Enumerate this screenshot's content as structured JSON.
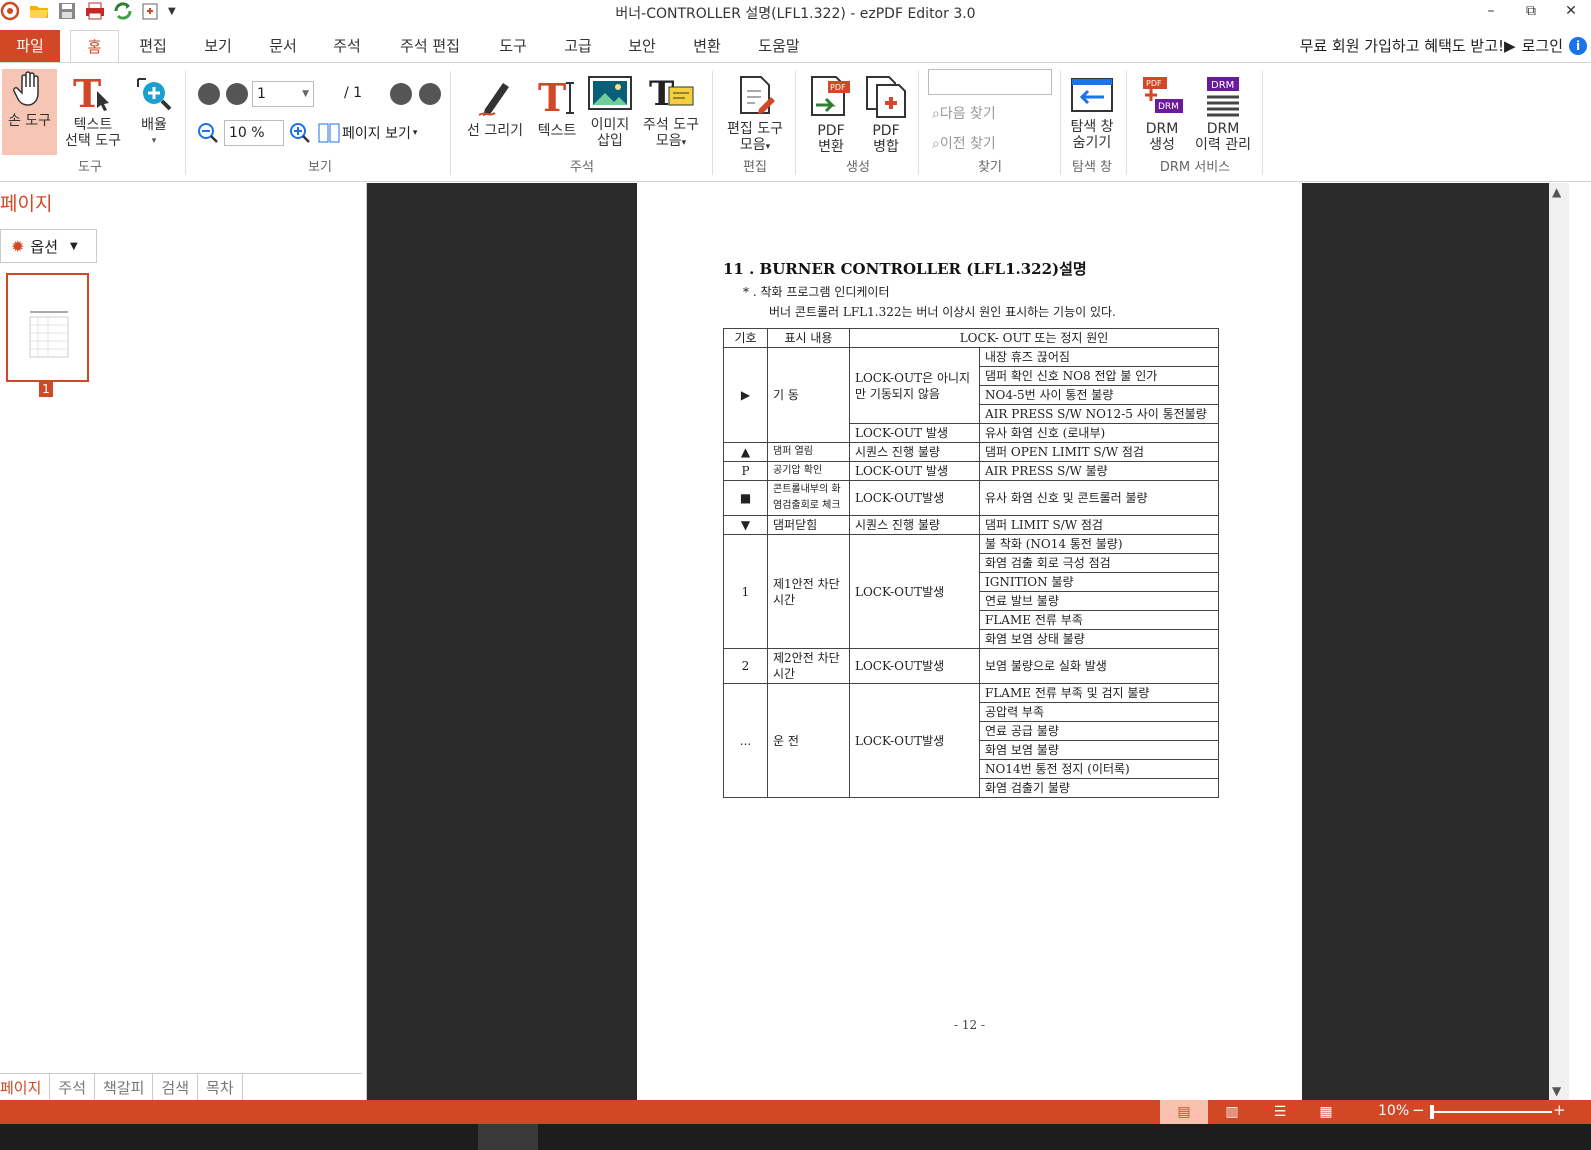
{
  "window": {
    "title": "버너-CONTROLLER 설명(LFL1.322) -  ezPDF Editor 3.0",
    "minimize": "–",
    "restore": "⧉",
    "close": "✕"
  },
  "tabs": {
    "file": "파일",
    "items": [
      "홈",
      "편집",
      "보기",
      "문서",
      "주석",
      "주석 편집",
      "도구",
      "고급",
      "보안",
      "변환",
      "도움말"
    ]
  },
  "promo": {
    "text": "무료 회원 가입하고 혜택도 받고!▶",
    "login": "로그인"
  },
  "ribbon": {
    "hand_tool": "손 도구",
    "text_select_1": "텍스트",
    "text_select_2": "선택 도구",
    "zoom_btn": "배율",
    "group_tools": "도구",
    "page_input": "1",
    "page_total": "/ 1",
    "zoom_input": "10 %",
    "page_view": "페이지 보기",
    "group_view": "보기",
    "draw_line": "선 그리기",
    "text_tool": "텍스트",
    "image_insert_1": "이미지",
    "image_insert_2": "삽입",
    "annot_tools_1": "주석 도구",
    "annot_tools_2": "모음",
    "group_annot": "주석",
    "edit_tools_1": "편집 도구",
    "edit_tools_2": "모음",
    "group_edit": "편집",
    "pdf_convert_1": "PDF",
    "pdf_convert_2": "변환",
    "pdf_merge_1": "PDF",
    "pdf_merge_2": "병합",
    "group_create": "생성",
    "find_next": "다음 찾기",
    "find_prev": "이전 찾기",
    "group_find": "찾기",
    "hide_nav_1": "탐색 창",
    "hide_nav_2": "숨기기",
    "group_nav": "탐색 창",
    "drm_create_1": "DRM",
    "drm_create_2": "생성",
    "drm_history_1": "DRM",
    "drm_history_2": "이력 관리",
    "group_drm": "DRM 서비스"
  },
  "left_panel": {
    "title": "페이지",
    "options": "옵션",
    "thumb_num": "1",
    "tabs": [
      "페이지",
      "주석",
      "책갈피",
      "검색",
      "목차"
    ]
  },
  "document": {
    "heading": "11 . BURNER CONTROLLER (LFL1.322)설명",
    "sub1": "* . 착화 프로그램 인디케이터",
    "sub2": "버너 콘트롤러 LFL1.322는 버너 이상시 원인 표시하는 기능이 있다.",
    "col_symbol": "기호",
    "col_display": "표시 내용",
    "col_cause": "LOCK- OUT 또는 정지 원인",
    "r1_sym": "▶",
    "r1_disp": "기 동",
    "r1_a_state": "LOCK-OUT은 아니지만 기동되지 않음",
    "r1_a_c1": "내장 휴즈 끊어짐",
    "r1_a_c2": "댐퍼 확인 신호 NO8 전압 불 인가",
    "r1_a_c3": "NO4-5번 사이 통전 불량",
    "r1_a_c4": "AIR PRESS S/W NO12-5 사이 통전불량",
    "r1_b_state": "LOCK-OUT 발생",
    "r1_b_c1": "유사 화염 신호 (로내부)",
    "r2_sym": "▲",
    "r2_disp": "댐퍼 열림",
    "r2_state": "시퀀스 진행 불량",
    "r2_c1": "댐퍼 OPEN LIMIT S/W 점검",
    "r3_sym": "P",
    "r3_disp": "공기압 확인",
    "r3_state": "LOCK-OUT 발생",
    "r3_c1": "AIR PRESS S/W 불량",
    "r4_sym": "■",
    "r4_disp": "콘트롤내부의 화염검출회로 체크",
    "r4_state": "LOCK-OUT발생",
    "r4_c1": "유사 화염 신호 및 콘트롤러 불량",
    "r5_sym": "▼",
    "r5_disp": "댐퍼닫힘",
    "r5_state": "시퀀스 진행 불량",
    "r5_c1": "댐퍼 LIMIT S/W 점검",
    "r6_sym": "1",
    "r6_disp": "제1안전 차단 시간",
    "r6_state": "LOCK-OUT발생",
    "r6_c1": "불 착화 (NO14 통전 불량)",
    "r6_c2": "화염 검출 회로 극성 점검",
    "r6_c3": "IGNITION 불량",
    "r6_c4": "연료 발브 불량",
    "r6_c5": "FLAME 전류 부족",
    "r6_c6": "화염 보염 상태 불량",
    "r7_sym": "2",
    "r7_disp": "제2안전 차단 시간",
    "r7_state": "LOCK-OUT발생",
    "r7_c1": "보염 불량으로 실화 발생",
    "r8_sym": "...",
    "r8_disp": "운 전",
    "r8_state": "LOCK-OUT발생",
    "r8_c1": "FLAME 전류 부족 및 검지 불량",
    "r8_c2": "공압력 부족",
    "r8_c3": "연료 공급 불량",
    "r8_c4": "화염 보염 불량",
    "r8_c5": "NO14번 통전 정지 (이터록)",
    "r8_c6": "화염 검출기 불량",
    "footer": "- 12 -"
  },
  "statusbar": {
    "zoom": "10%",
    "minus": "−",
    "plus": "+"
  }
}
